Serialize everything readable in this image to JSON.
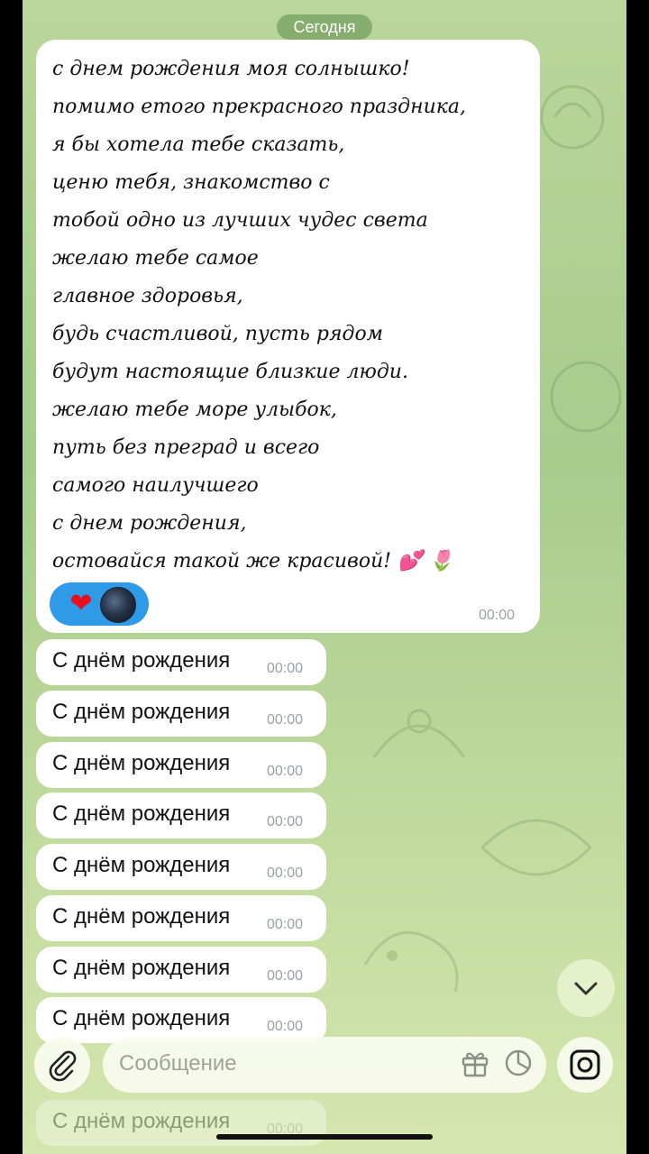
{
  "chat": {
    "date_label": "Сегодня",
    "long_message": {
      "text": "с днем рождения моя солнышко!\nпомимо етого прекрасного праздника,\nя бы хотела тебе сказать,\nценю тебя, знакомство с\nтобой одно из лучших чудес света\nжелаю тебе самое\nглавное здоровья,\nбудь счастливой, пусть рядом\nбудут настоящие близкие люди.\nжелаю тебе море улыбок,\nпуть без преград и всего\nсамого наилучшего\nс днем рождения,\nостовайся такой же красивой! 💕 🌷",
      "time": "00:00",
      "reactions": [
        "heart",
        "avatar"
      ],
      "reaction_heart_glyph": "❤"
    },
    "messages": [
      {
        "text": "С днём рождения",
        "time": "00:00"
      },
      {
        "text": "С днём рождения",
        "time": "00:00"
      },
      {
        "text": "С днём рождения",
        "time": "00:00"
      },
      {
        "text": "С днём рождения",
        "time": "00:00"
      },
      {
        "text": "С днём рождения",
        "time": "00:00"
      },
      {
        "text": "С днём рождения",
        "time": "00:00"
      },
      {
        "text": "С днём рождения",
        "time": "00:00"
      },
      {
        "text": "С днём рождения",
        "time": "00:00"
      },
      {
        "text": "С днём рождения",
        "time": "00:00"
      }
    ]
  },
  "composer": {
    "placeholder": "Сообщение",
    "icons": [
      "paperclip-icon",
      "gift-icon",
      "sticker-icon",
      "camera-icon"
    ]
  },
  "colors": {
    "bubble": "#ffffff",
    "reaction_pill": "#2f9ae8",
    "chat_background": "#b9d79a"
  }
}
